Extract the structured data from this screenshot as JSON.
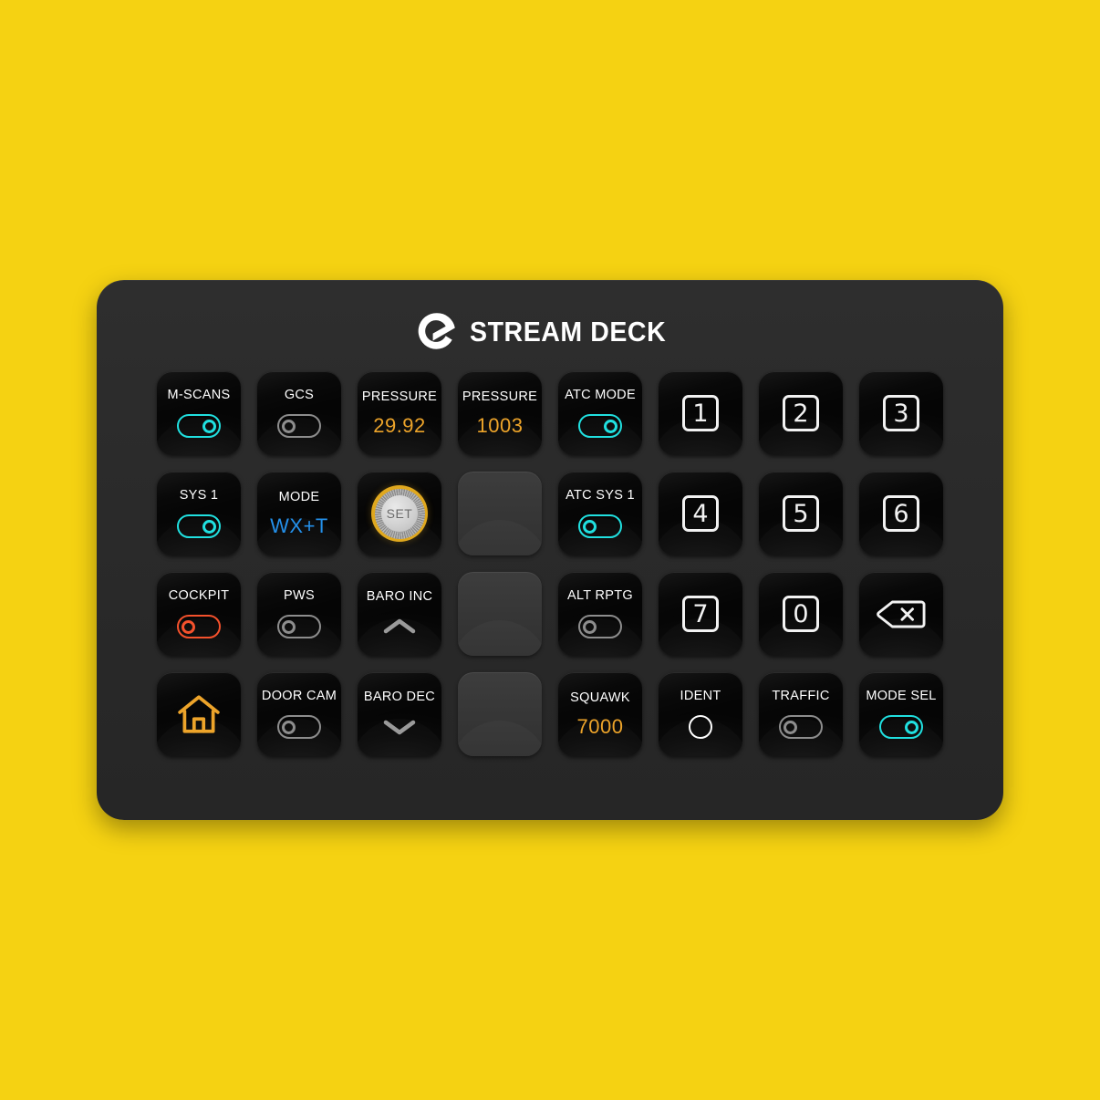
{
  "background_color": "#f5d212",
  "device": {
    "body_color": "#2a2a2a",
    "brand_name": "STREAM DECK",
    "logo_icon": "elgato-logo-icon"
  },
  "colors": {
    "accent_cyan": "#20e0e0",
    "accent_amber": "#eda42a",
    "accent_blue": "#2490ea",
    "accent_red": "#f4512c",
    "label_white": "#ffffff",
    "toggle_off_gray": "#8d8d8d"
  },
  "keys": [
    {
      "row": 1,
      "col": 1,
      "name": "m-scans",
      "type": "toggle",
      "label": "M-SCANS",
      "state": "on",
      "color": "cyan",
      "blank": false
    },
    {
      "row": 1,
      "col": 2,
      "name": "gcs",
      "type": "toggle",
      "label": "GCS",
      "state": "off",
      "color": "gray",
      "blank": false
    },
    {
      "row": 1,
      "col": 3,
      "name": "pressure-inhg",
      "type": "value",
      "label": "PRESSURE",
      "value": "29.92",
      "value_color": "amber",
      "blank": false
    },
    {
      "row": 1,
      "col": 4,
      "name": "pressure-hpa",
      "type": "value",
      "label": "PRESSURE",
      "value": "1003",
      "value_color": "amber",
      "blank": false
    },
    {
      "row": 1,
      "col": 5,
      "name": "atc-mode",
      "type": "toggle",
      "label": "ATC MODE",
      "state": "on",
      "color": "cyan",
      "blank": false
    },
    {
      "row": 1,
      "col": 6,
      "name": "numpad-1",
      "type": "numkey",
      "value": "1",
      "blank": false
    },
    {
      "row": 1,
      "col": 7,
      "name": "numpad-2",
      "type": "numkey",
      "value": "2",
      "blank": false
    },
    {
      "row": 1,
      "col": 8,
      "name": "numpad-3",
      "type": "numkey",
      "value": "3",
      "blank": false
    },
    {
      "row": 2,
      "col": 1,
      "name": "sys-1",
      "type": "toggle",
      "label": "SYS 1",
      "state": "on",
      "color": "cyan",
      "blank": false
    },
    {
      "row": 2,
      "col": 2,
      "name": "mode",
      "type": "value",
      "label": "MODE",
      "value": "WX+T",
      "value_color": "blue",
      "blank": false
    },
    {
      "row": 2,
      "col": 3,
      "name": "baro-set-knob",
      "type": "knob",
      "knob_label": "SET",
      "blank": false
    },
    {
      "row": 2,
      "col": 4,
      "name": "empty-key-r2c4",
      "type": "empty",
      "blank": true
    },
    {
      "row": 2,
      "col": 5,
      "name": "atc-sys-1",
      "type": "toggle",
      "label": "ATC SYS 1",
      "state": "off",
      "color": "cyan",
      "blank": false
    },
    {
      "row": 2,
      "col": 6,
      "name": "numpad-4",
      "type": "numkey",
      "value": "4",
      "blank": false
    },
    {
      "row": 2,
      "col": 7,
      "name": "numpad-5",
      "type": "numkey",
      "value": "5",
      "blank": false
    },
    {
      "row": 2,
      "col": 8,
      "name": "numpad-6",
      "type": "numkey",
      "value": "6",
      "blank": false
    },
    {
      "row": 3,
      "col": 1,
      "name": "cockpit",
      "type": "toggle",
      "label": "COCKPIT",
      "state": "off",
      "color": "red",
      "blank": false
    },
    {
      "row": 3,
      "col": 2,
      "name": "pws",
      "type": "toggle",
      "label": "PWS",
      "state": "off",
      "color": "gray",
      "blank": false
    },
    {
      "row": 3,
      "col": 3,
      "name": "baro-inc",
      "type": "chevron",
      "label": "BARO INC",
      "direction": "up",
      "blank": false
    },
    {
      "row": 3,
      "col": 4,
      "name": "empty-key-r3c4",
      "type": "empty",
      "blank": true
    },
    {
      "row": 3,
      "col": 5,
      "name": "alt-rptg",
      "type": "toggle",
      "label": "ALT RPTG",
      "state": "off",
      "color": "gray",
      "blank": false
    },
    {
      "row": 3,
      "col": 6,
      "name": "numpad-7",
      "type": "numkey",
      "value": "7",
      "blank": false
    },
    {
      "row": 3,
      "col": 7,
      "name": "numpad-0",
      "type": "numkey",
      "value": "0",
      "blank": false
    },
    {
      "row": 3,
      "col": 8,
      "name": "backspace",
      "type": "icon",
      "icon": "backspace-icon",
      "blank": false
    },
    {
      "row": 4,
      "col": 1,
      "name": "home",
      "type": "icon",
      "icon": "home-icon",
      "blank": false
    },
    {
      "row": 4,
      "col": 2,
      "name": "door-cam",
      "type": "toggle",
      "label": "DOOR CAM",
      "state": "off",
      "color": "gray",
      "blank": false
    },
    {
      "row": 4,
      "col": 3,
      "name": "baro-dec",
      "type": "chevron",
      "label": "BARO DEC",
      "direction": "down",
      "blank": false
    },
    {
      "row": 4,
      "col": 4,
      "name": "empty-key-r4c4",
      "type": "empty",
      "blank": true
    },
    {
      "row": 4,
      "col": 5,
      "name": "squawk",
      "type": "value",
      "label": "SQUAWK",
      "value": "7000",
      "value_color": "amber",
      "blank": false
    },
    {
      "row": 4,
      "col": 6,
      "name": "ident",
      "type": "circle",
      "label": "IDENT",
      "blank": false
    },
    {
      "row": 4,
      "col": 7,
      "name": "traffic",
      "type": "toggle",
      "label": "TRAFFIC",
      "state": "off",
      "color": "gray",
      "blank": false
    },
    {
      "row": 4,
      "col": 8,
      "name": "mode-sel",
      "type": "toggle",
      "label": "MODE SEL",
      "state": "on",
      "color": "cyan",
      "blank": false
    }
  ]
}
